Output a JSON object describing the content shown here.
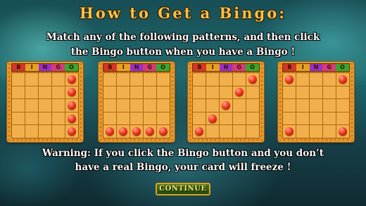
{
  "title": "How to Get a Bingo:",
  "instructions": {
    "line1": "Match any of the following patterns, and then click",
    "line2": "the Bingo button when you have a Bingo !"
  },
  "warning": {
    "line1": "Warning: If you click the Bingo button and you don’t",
    "line2": "have a real Bingo, your card will freeze !"
  },
  "bingo_header": {
    "letters": [
      "B",
      "I",
      "N",
      "G",
      "O"
    ],
    "colors": [
      "#d8352a",
      "#e8a020",
      "#9a2fc8",
      "#d83a7a",
      "#38a830"
    ]
  },
  "patterns": [
    {
      "name": "vertical-column",
      "marked": [
        [
          0,
          4
        ],
        [
          1,
          4
        ],
        [
          2,
          4
        ],
        [
          3,
          4
        ],
        [
          4,
          4
        ]
      ]
    },
    {
      "name": "horizontal-row",
      "marked": [
        [
          4,
          0
        ],
        [
          4,
          1
        ],
        [
          4,
          2
        ],
        [
          4,
          3
        ],
        [
          4,
          4
        ]
      ]
    },
    {
      "name": "diagonal",
      "marked": [
        [
          0,
          4
        ],
        [
          1,
          3
        ],
        [
          2,
          2
        ],
        [
          3,
          1
        ],
        [
          4,
          0
        ]
      ]
    },
    {
      "name": "four-corners",
      "marked": [
        [
          0,
          0
        ],
        [
          0,
          4
        ],
        [
          4,
          0
        ],
        [
          4,
          4
        ]
      ]
    }
  ],
  "continue_label": "CONTINUE",
  "colors": {
    "title": "#f6c24a",
    "card": "#e69a2e",
    "ball": "#e0281a",
    "button": "#2e5e10"
  }
}
